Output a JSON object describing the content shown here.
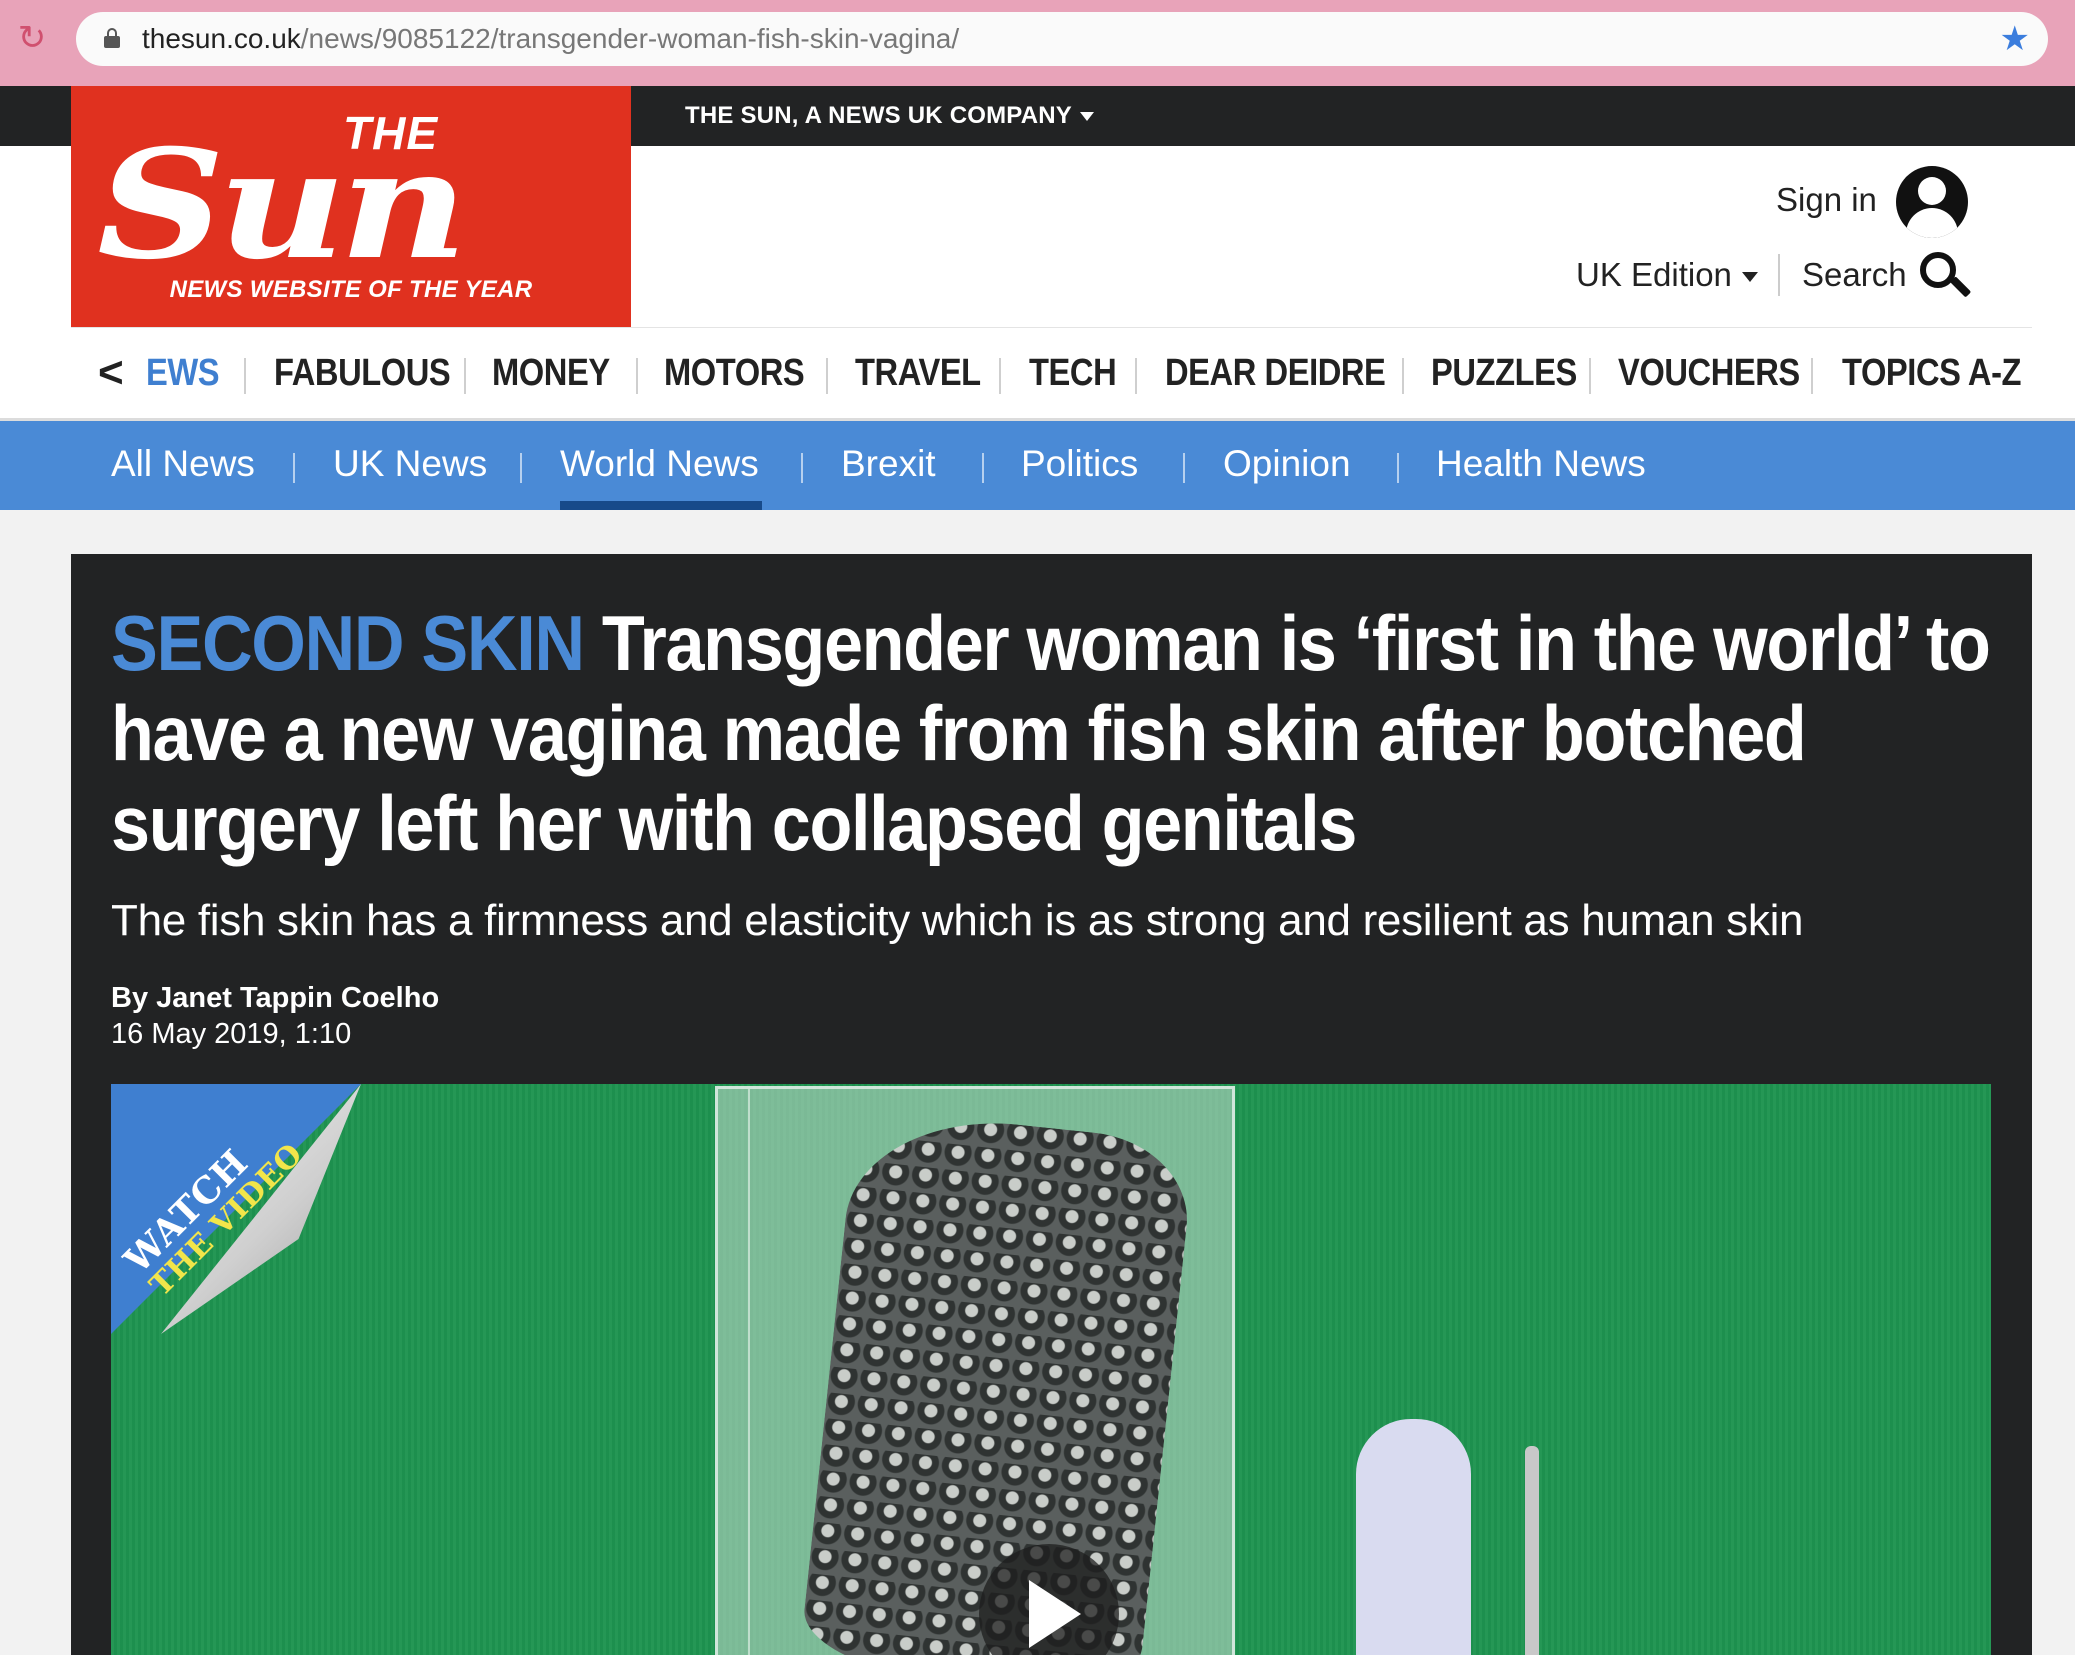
{
  "browser": {
    "url_domain": "thesun.co.uk",
    "url_path": "/news/9085122/transgender-woman-fish-skin-vagina/",
    "reload_icon": "reload-icon",
    "lock_icon": "lock-icon",
    "bookmark_icon": "star-icon"
  },
  "header": {
    "company_label": "THE SUN, A NEWS UK COMPANY",
    "logo_the": "THE",
    "logo_sun": "Sun",
    "logo_tagline": "NEWS WEBSITE OF THE YEAR",
    "sign_in": "Sign in",
    "edition": "UK Edition",
    "search": "Search"
  },
  "main_nav": {
    "items": [
      "EWS",
      "FABULOUS",
      "MONEY",
      "MOTORS",
      "TRAVEL",
      "TECH",
      "DEAR DEIDRE",
      "PUZZLES",
      "VOUCHERS",
      "TOPICS A-Z"
    ]
  },
  "sub_nav": {
    "items": [
      "All News",
      "UK News",
      "World News",
      "Brexit",
      "Politics",
      "Opinion",
      "Health News"
    ],
    "active": "World News"
  },
  "article": {
    "kicker": "SECOND SKIN",
    "headline": "Transgender woman is ‘first in the world’ to have a new vagina made from fish skin after botched surgery left her with collapsed genitals",
    "standfirst": "The fish skin has a firmness and elasticity which is as strong and resilient as human skin",
    "byline": "By Janet Tappin Coelho",
    "date": "16 May 2019, 1:10"
  },
  "media": {
    "badge_line1": "WATCH",
    "badge_line2": "THE VIDEO",
    "play_icon": "play-icon"
  },
  "colors": {
    "brand_red": "#e0311f",
    "nav_blue": "#4a8ad6",
    "kicker_blue": "#4a8ad6",
    "article_bg": "#222324"
  }
}
